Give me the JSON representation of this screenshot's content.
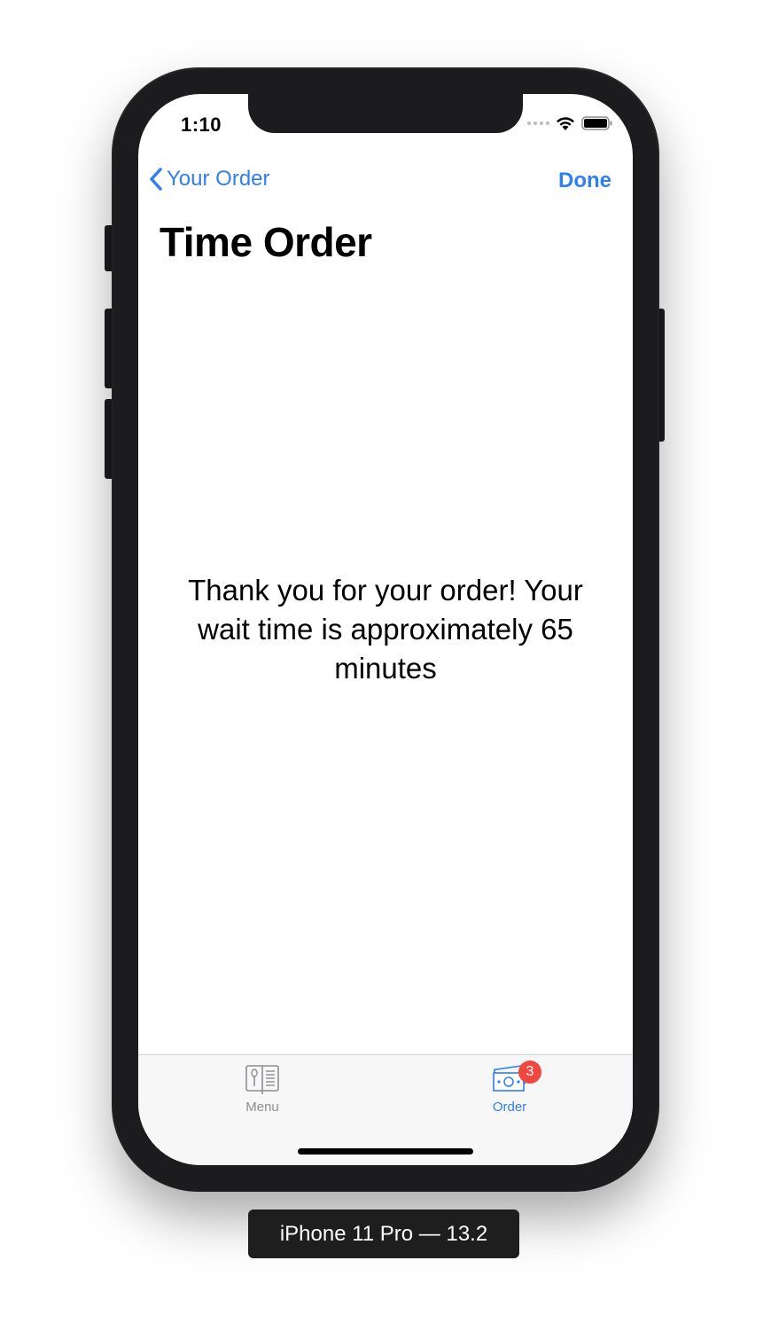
{
  "status_bar": {
    "time": "1:10"
  },
  "nav": {
    "back_label": "Your Order",
    "done_label": "Done",
    "title": "Time Order"
  },
  "content": {
    "message": "Thank you for your order! Your wait time is approximately 65 minutes"
  },
  "tab_bar": {
    "items": [
      {
        "label": "Menu",
        "icon": "menu-book-icon",
        "selected": false
      },
      {
        "label": "Order",
        "icon": "money-icon",
        "selected": true,
        "badge": "3"
      }
    ]
  },
  "device_label": "iPhone 11 Pro — 13.2",
  "colors": {
    "accent": "#2f7ef2",
    "badge": "#f0483e",
    "tab_inactive": "#8e8e93"
  }
}
